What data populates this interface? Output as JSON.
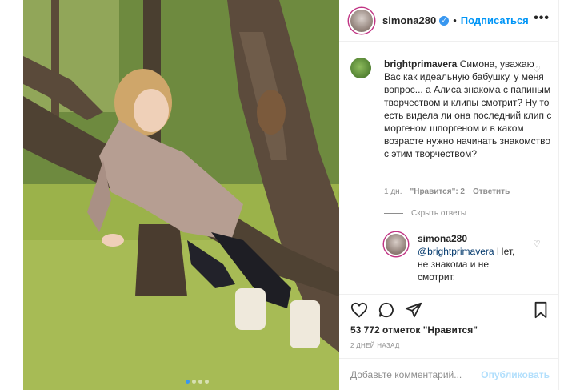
{
  "post": {
    "author": "simona280",
    "verified": true,
    "separator": "•",
    "follow_label": "Подписаться",
    "more": "•••"
  },
  "comments": [
    {
      "user": "brightprimavera",
      "text": "Симона, уважаю Вас как идеальную бабушку, у меня вопрос... а Алиса знакома с папиным творчеством и клипы смотрит? Ну то есть видела ли она последний клип с моргеном шпоргеном и в каком возрасте нужно начинать знакомство с этим творчеством?",
      "time": "1 дн.",
      "likes": "\"Нравится\": 2",
      "reply_label": "Ответить",
      "heart": "♡"
    }
  ],
  "replies_toggle": "Скрыть ответы",
  "reply": {
    "user": "simona280",
    "mention": "@brightprimavera",
    "text": " Нет, не знакома и не смотрит.",
    "heart": "♡"
  },
  "likes_text": "53 772 отметок \"Нравится\"",
  "date_text": "2 ДНЕЙ НАЗАД",
  "add_comment": {
    "placeholder": "Добавьте комментарий...",
    "publish_label": "Опубликовать"
  },
  "carousel": {
    "next_glyph": "›",
    "slide_count": 4,
    "active_slide": 1
  },
  "colors": {
    "link": "#0095f6",
    "publish_disabled": "#b2dffc",
    "active_dot": "#3897f0"
  }
}
